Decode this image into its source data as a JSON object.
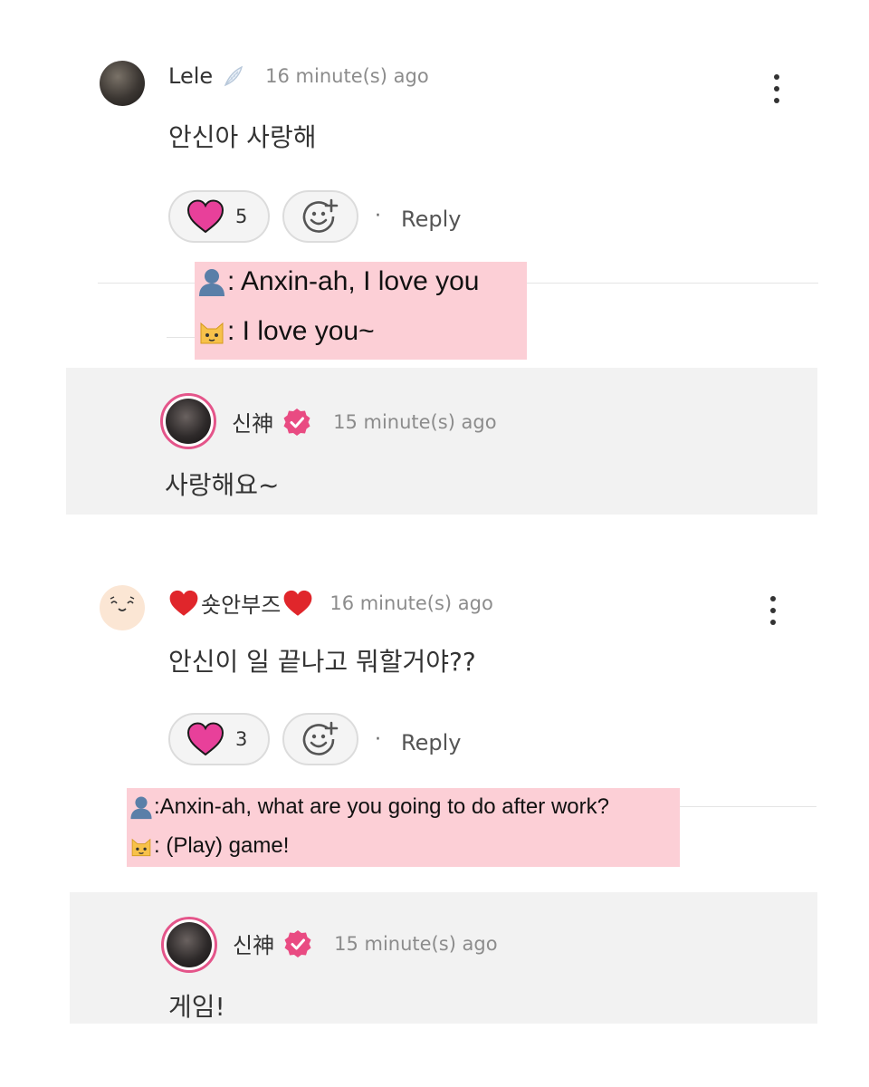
{
  "comments": [
    {
      "author": "Lele",
      "time": "16 minute(s) ago",
      "text": "안신아 사랑해",
      "likes": "5",
      "reply_label": "Reply",
      "translation": {
        "line1": ": Anxin-ah, I love you",
        "line2": ": I love you~"
      },
      "reply": {
        "author": "신神",
        "time": "15 minute(s) ago",
        "text": "사랑해요~"
      }
    },
    {
      "author": "숏안부즈",
      "time": "16 minute(s) ago",
      "text": "안신이 일 끝나고 뭐할거야??",
      "likes": "3",
      "reply_label": "Reply",
      "translation": {
        "line1": ":Anxin-ah, what are you going to do after work?",
        "line2": ": (Play) game!"
      },
      "reply": {
        "author": "신神",
        "time": "15 minute(s) ago",
        "text": "게임!"
      }
    }
  ],
  "icons": {
    "heart": "heart-icon",
    "add_reaction": "add-reaction-icon",
    "more": "more-vertical-icon",
    "verified": "verified-badge-icon",
    "person": "person-icon",
    "cat": "cat-face-icon",
    "feather": "feather-icon"
  },
  "colors": {
    "heart": "#e8409a",
    "verified": "#e94b82",
    "translation_bg": "#fccfd6",
    "reply_bg": "#f2f2f2"
  }
}
